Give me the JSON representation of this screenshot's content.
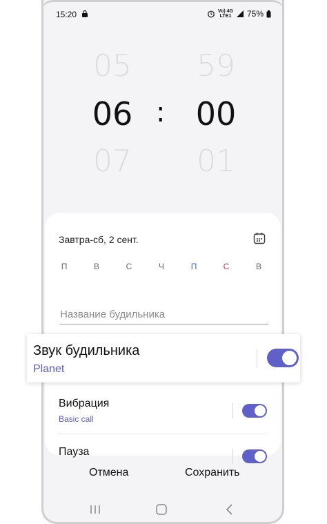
{
  "status_bar": {
    "time": "15:20",
    "network_label": "Vo) 4G\nLTE1",
    "battery": "75%"
  },
  "time_picker": {
    "hour_prev": "05",
    "hour": "06",
    "hour_next": "07",
    "separator": ":",
    "minute_prev": "59",
    "minute": "00",
    "minute_next": "01"
  },
  "schedule": {
    "date_label": "Завтра-сб, 2 сент.",
    "days": [
      {
        "label": "П",
        "color": "#666666"
      },
      {
        "label": "В",
        "color": "#666666"
      },
      {
        "label": "С",
        "color": "#666666"
      },
      {
        "label": "Ч",
        "color": "#666666"
      },
      {
        "label": "П",
        "color": "#3b6fd8"
      },
      {
        "label": "С",
        "color": "#d23b3b"
      },
      {
        "label": "В",
        "color": "#666666"
      }
    ]
  },
  "alarm_name": {
    "placeholder": "Название будильника"
  },
  "sound": {
    "title": "Звук будильника",
    "value": "Planet",
    "enabled": true
  },
  "vibration": {
    "title": "Вибрация",
    "value": "Basic call",
    "enabled": true
  },
  "pause": {
    "title": "Пауза",
    "enabled": true
  },
  "actions": {
    "cancel": "Отмена",
    "save": "Сохранить"
  },
  "colors": {
    "accent": "#5f60c8",
    "sub_text": "#5a5cc4",
    "background": "#f4f4f6"
  },
  "nav_icons": [
    "recent-apps-icon",
    "home-icon",
    "back-icon"
  ]
}
